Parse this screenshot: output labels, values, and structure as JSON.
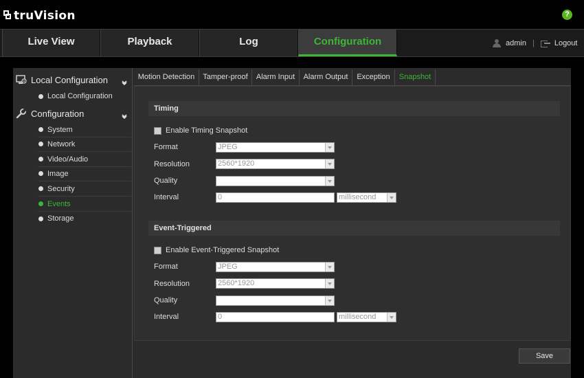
{
  "brand": {
    "logo_text": "truVision"
  },
  "nav": {
    "tabs": [
      {
        "label": "Live View"
      },
      {
        "label": "Playback"
      },
      {
        "label": "Log"
      },
      {
        "label": "Configuration"
      }
    ],
    "user": "admin",
    "separator": "|",
    "logout": "Logout",
    "help": "?"
  },
  "sidebar": {
    "groups": [
      {
        "label": "Local Configuration",
        "items": [
          "Local Configuration"
        ]
      },
      {
        "label": "Configuration",
        "items": [
          "System",
          "Network",
          "Video/Audio",
          "Image",
          "Security",
          "Events",
          "Storage"
        ]
      }
    ],
    "active_item": "Events"
  },
  "subtabs": [
    "Motion Detection",
    "Tamper-proof",
    "Alarm Input",
    "Alarm Output",
    "Exception",
    "Snapshot"
  ],
  "active_subtab": "Snapshot",
  "timing": {
    "title": "Timing",
    "enable_label": "Enable Timing Snapshot",
    "format_label": "Format",
    "format_value": "JPEG",
    "resolution_label": "Resolution",
    "resolution_value": "2560*1920",
    "quality_label": "Quality",
    "quality_value": "",
    "interval_label": "Interval",
    "interval_value": "0",
    "interval_unit": "millisecond"
  },
  "event": {
    "title": "Event-Triggered",
    "enable_label": "Enable Event-Triggered Snapshot",
    "format_label": "Format",
    "format_value": "JPEG",
    "resolution_label": "Resolution",
    "resolution_value": "2560*1920",
    "quality_label": "Quality",
    "quality_value": "",
    "interval_label": "Interval",
    "interval_value": "0",
    "interval_unit": "millisecond"
  },
  "save_label": "Save",
  "colors": {
    "accent": "#3fb537",
    "background": "#000000",
    "panel": "#2b2b2b"
  }
}
